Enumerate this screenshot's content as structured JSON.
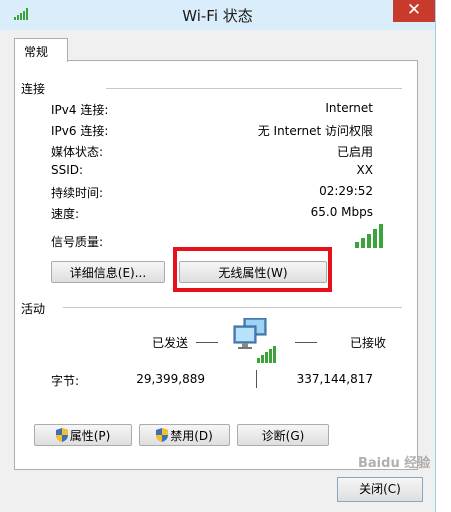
{
  "window": {
    "title": "Wi-Fi 状态",
    "close_glyph": "✕"
  },
  "tab": {
    "label": "常规"
  },
  "connection": {
    "heading": "连接",
    "rows": [
      {
        "label": "IPv4 连接:",
        "value": "Internet"
      },
      {
        "label": "IPv6 连接:",
        "value": "无 Internet 访问权限"
      },
      {
        "label": "媒体状态:",
        "value": "已启用"
      },
      {
        "label": "SSID:",
        "value": "XX"
      },
      {
        "label": "持续时间:",
        "value": "02:29:52"
      },
      {
        "label": "速度:",
        "value": "65.0 Mbps"
      }
    ],
    "signal_label": "信号质量:",
    "signal_bars": 5,
    "details_button": "详细信息(E)...",
    "wireless_props_button": "无线属性(W)"
  },
  "activity": {
    "heading": "活动",
    "sent_label": "已发送",
    "received_label": "已接收",
    "bytes_label": "字节:",
    "bytes_sent": "29,399,889",
    "bytes_received": "337,144,817"
  },
  "buttons": {
    "properties": "属性(P)",
    "disable": "禁用(D)",
    "diagnose": "诊断(G)",
    "close": "关闭(C)"
  },
  "colors": {
    "signal_green": "#3aa33a",
    "highlight_red": "#e8101a",
    "title_bg": "#d9eefa",
    "close_red": "#c83a2c"
  },
  "watermark": "Baidu 经验"
}
